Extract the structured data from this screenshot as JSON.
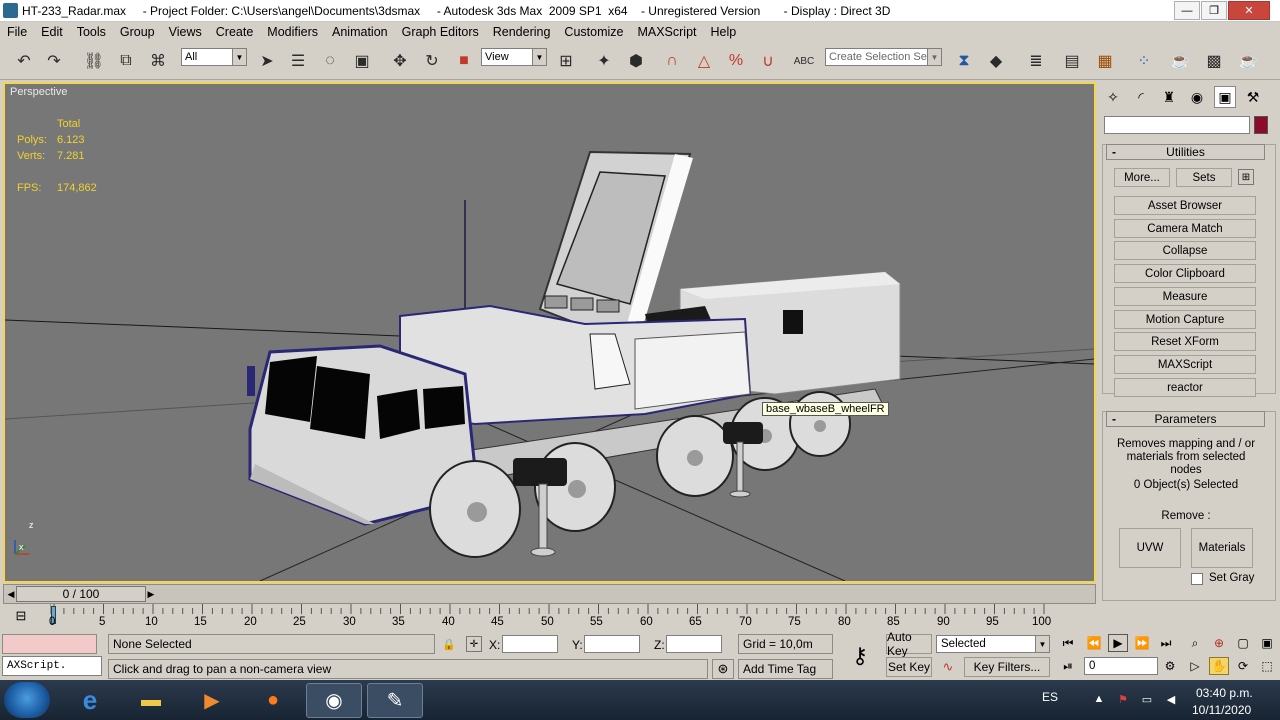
{
  "window": {
    "title": "HT-233_Radar.max     - Project Folder: C:\\Users\\angel\\Documents\\3dsmax     - Autodesk 3ds Max  2009 SP1  x64    - Unregistered Version       - Display : Direct 3D",
    "minimize": "—",
    "maximize": "❐",
    "close": "✕"
  },
  "menu": [
    "File",
    "Edit",
    "Tools",
    "Group",
    "Views",
    "Create",
    "Modifiers",
    "Animation",
    "Graph Editors",
    "Rendering",
    "Customize",
    "MAXScript",
    "Help"
  ],
  "toolbar": {
    "selection_filter": "All",
    "reference_coord": "View",
    "named_selection_placeholder": "Create Selection Set"
  },
  "viewport": {
    "label": "Perspective",
    "stats_header": "Total",
    "polys_label": "Polys:",
    "polys_value": "6.123",
    "verts_label": "Verts:",
    "verts_value": "7.281",
    "fps_label": "FPS:",
    "fps_value": "174,862",
    "tooltip": "base_wbaseB_wheelFR",
    "axis_z": "z",
    "axis_x": "x"
  },
  "command_panel": {
    "utilities_title": "Utilities",
    "more_button": "More...",
    "sets_button": "Sets",
    "utilities": [
      "Asset Browser",
      "Camera Match",
      "Collapse",
      "Color Clipboard",
      "Measure",
      "Motion Capture",
      "Reset XForm",
      "MAXScript",
      "reactor"
    ],
    "parameters_title": "Parameters",
    "description": "Removes mapping and / or materials from selected nodes",
    "selected_count": "0 Object(s) Selected",
    "remove_label": "Remove :",
    "uvw_button": "UVW",
    "materials_button": "Materials",
    "set_gray_label": "Set Gray",
    "object_color": "#8c0b2c"
  },
  "timeline": {
    "frame_display": "0 / 100",
    "ticks": [
      "0",
      "5",
      "10",
      "15",
      "20",
      "25",
      "30",
      "35",
      "40",
      "45",
      "50",
      "55",
      "60",
      "65",
      "70",
      "75",
      "80",
      "85",
      "90",
      "95",
      "100"
    ]
  },
  "status": {
    "maxscript_label": "AXScript.",
    "selection_status": "None Selected",
    "prompt": "Click and drag to pan a non-camera view",
    "x_label": "X:",
    "y_label": "Y:",
    "z_label": "Z:",
    "grid": "Grid = 10,0m",
    "add_time_tag": "Add Time Tag",
    "auto_key": "Auto Key",
    "set_key": "Set Key",
    "key_mode_value": "Selected",
    "key_filters": "Key Filters...",
    "current_frame": "0"
  },
  "taskbar": {
    "language": "ES",
    "time": "03:40 p.m.",
    "date": "10/11/2020"
  }
}
